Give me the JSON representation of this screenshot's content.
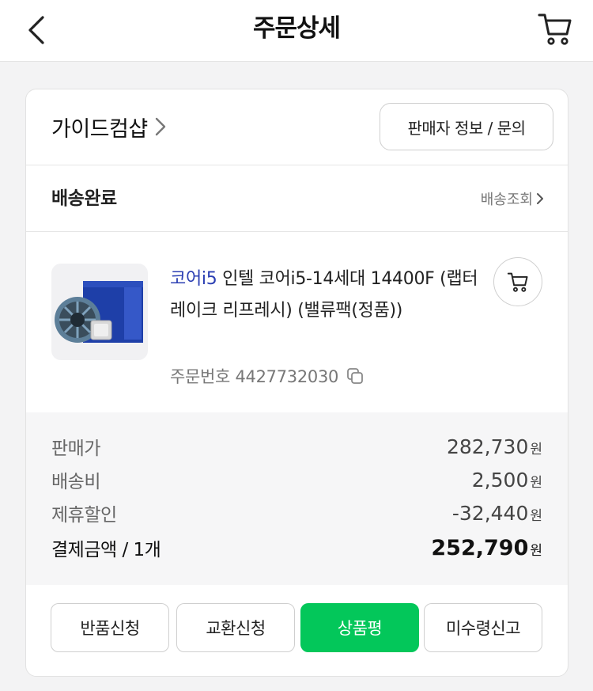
{
  "header": {
    "title": "주문상세",
    "back_icon": "chevron-left-icon",
    "cart_icon": "cart-icon"
  },
  "seller": {
    "name": "가이드컴샵",
    "info_button": "판매자 정보 / 문의"
  },
  "delivery": {
    "status": "배송완료",
    "track_link": "배송조회"
  },
  "product": {
    "brand": "코어i5",
    "title": " 인텔 코어i5-14세대 14400F (랩터레이크 리프레시) (밸류팩(정품))",
    "order_number": "주문번호 4427732030",
    "thumbnail_icon": "cpu-box-image"
  },
  "prices": {
    "rows": [
      {
        "label": "판매가",
        "value": "282,730",
        "unit": "원"
      },
      {
        "label": "배송비",
        "value": "2,500",
        "unit": "원"
      },
      {
        "label": "제휴할인",
        "value": "-32,440",
        "unit": "원"
      }
    ],
    "total": {
      "label": "결제금액 / 1개",
      "value": "252,790",
      "unit": "원"
    }
  },
  "actions": {
    "return_label": "반품신청",
    "exchange_label": "교환신청",
    "review_label": "상품평",
    "not_received_label": "미수령신고"
  },
  "colors": {
    "accent_green": "#03c75a",
    "brand_blue": "#2b3fb3"
  }
}
